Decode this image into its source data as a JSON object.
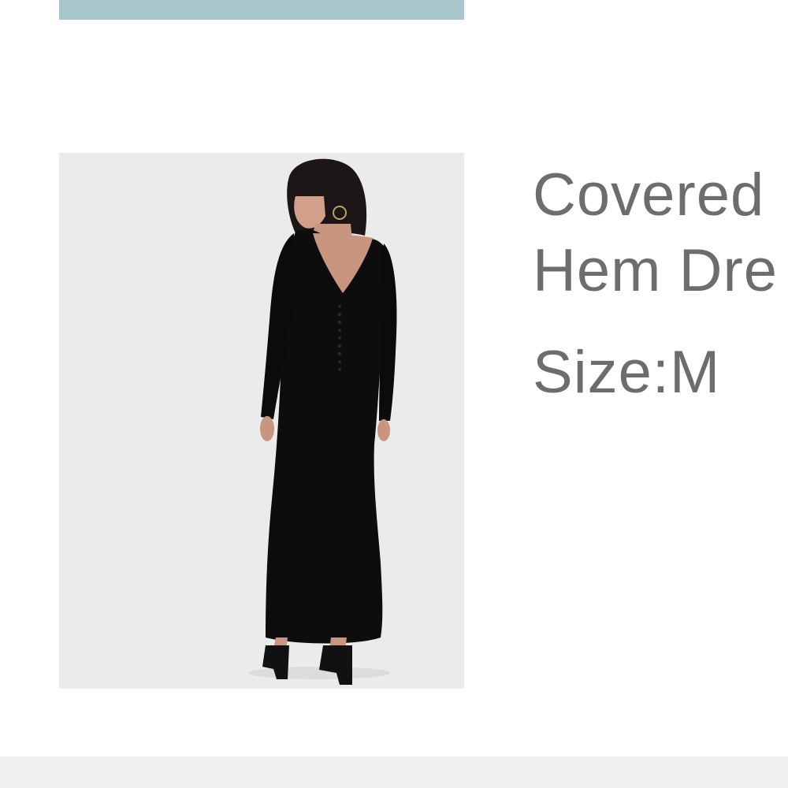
{
  "cart_item": {
    "title_line_1": "Covered",
    "title_line_2": "Hem Dre",
    "size_label": "Size:",
    "size_value": "M"
  },
  "colors": {
    "top_strip": "#a7c6cb",
    "image_background": "#ebebeb",
    "text": "#6d6d6d",
    "bottom_bar": "#efefef"
  }
}
